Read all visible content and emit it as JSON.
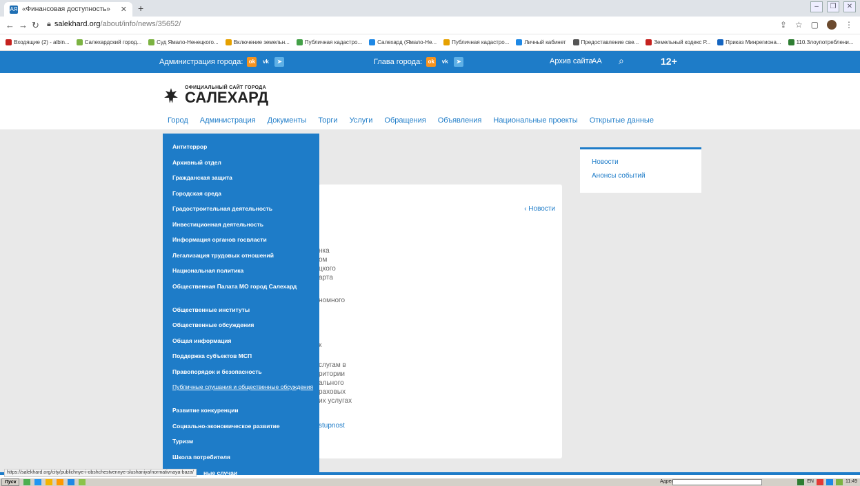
{
  "browser": {
    "tab_title": "«Финансовая доступность»",
    "tab_favicon": "АЯ",
    "new_tab": "+",
    "url_domain": "salekhard.org",
    "url_path": "/about/info/news/35652/",
    "bookmarks": [
      {
        "label": "Входящие (2) - albin...",
        "color": "#c5221f"
      },
      {
        "label": "Салехардский город...",
        "color": "#7cb342"
      },
      {
        "label": "Суд Ямало-Ненецкого...",
        "color": "#7cb342"
      },
      {
        "label": "Включение земельн...",
        "color": "#e6a100"
      },
      {
        "label": "Публичная кадастро...",
        "color": "#43a047"
      },
      {
        "label": "Салехард (Ямало-Не...",
        "color": "#1e88e5"
      },
      {
        "label": "Публичная кадастро...",
        "color": "#e6a100"
      },
      {
        "label": "Личный кабинет",
        "color": "#1e88e5"
      },
      {
        "label": "Предоставление све...",
        "color": "#555555"
      },
      {
        "label": "Земельный кодекс Р...",
        "color": "#c5221f"
      },
      {
        "label": "Приказ Минрегиона...",
        "color": "#1565c0"
      },
      {
        "label": "110.Злоупотреблени...",
        "color": "#2e7d32"
      }
    ],
    "status_url": "https://salekhard.org/city/publichnye-i-obshchestvennye-slushaniya/normativnaya-baza/"
  },
  "sitebar": {
    "admin_label": "Администрация города:",
    "head_label": "Глава города:",
    "archive_label": "Архив сайта",
    "font_label": "AA",
    "age_rating": "12+"
  },
  "header": {
    "logo_sub": "ОФИЦИАЛЬНЫЙ САЙТ ГОРОДА",
    "logo_main": "САЛЕХАРД",
    "nav": [
      "Город",
      "Администрация",
      "Документы",
      "Торги",
      "Услуги",
      "Обращения",
      "Объявления",
      "Национальные проекты",
      "Открытые данные"
    ]
  },
  "dropdown": {
    "items": [
      "Антитеррор",
      "Архивный отдел",
      "Гражданская защита",
      "Городская среда",
      "Градостроительная деятельность",
      "Инвестиционная деятельность",
      "Информация органов госвласти",
      "Легализация трудовых отношений",
      "Национальная политика",
      "Общественная Палата МО город Салехард",
      "Общественные институты",
      "Общественные обсуждения",
      "Общая информация",
      "Поддержка субъектов МСП",
      "Правопорядок и безопасность",
      "Публичные слушания и общественные обсуждения",
      "Развитие конкуренции",
      "Социально-экономическое развитие",
      "Туризм",
      "Школа потребителя"
    ],
    "last_partial": "ные случаи"
  },
  "article": {
    "back_label": "‹ Новости",
    "fragments": [
      "нка",
      "ом",
      "цкого",
      "арта",
      "номного",
      "к",
      "слугам в",
      "ритории",
      "ального",
      "раховых",
      "их услугах",
      "stupnost"
    ]
  },
  "sidebar": {
    "links": [
      "Новости",
      "Анонсы событий"
    ]
  },
  "taskbar": {
    "start_label": "Пуск",
    "address_label": "Адрес",
    "lang": "EN",
    "clock": "11:49"
  }
}
